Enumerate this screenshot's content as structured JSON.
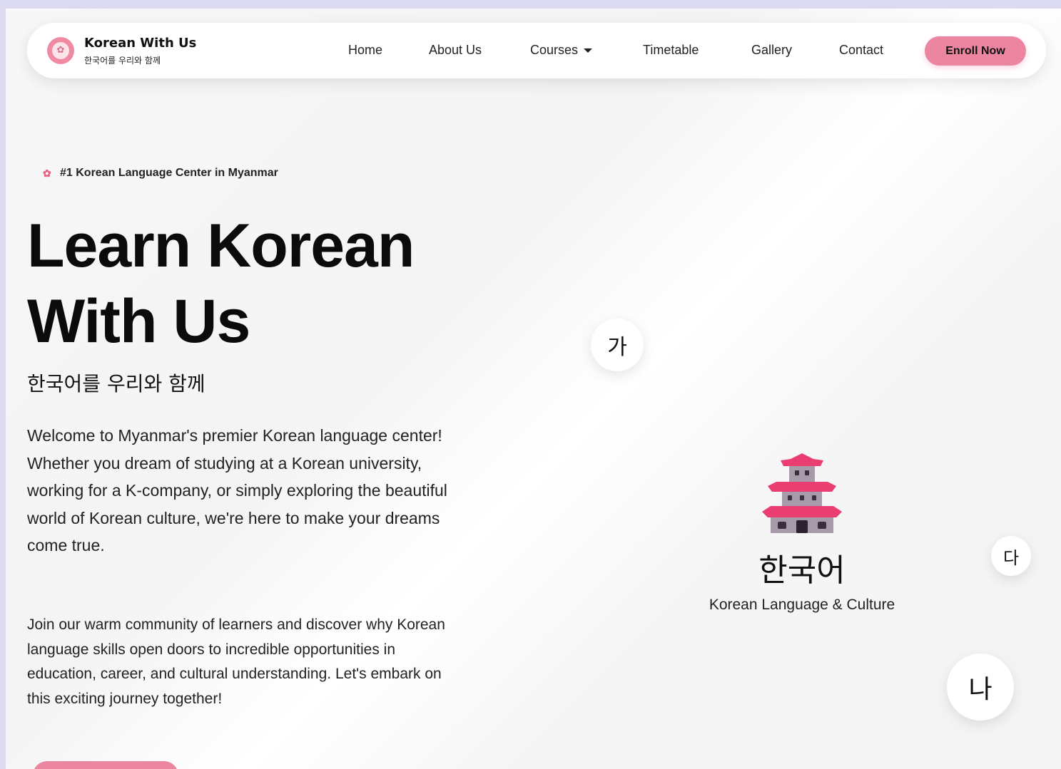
{
  "brand": {
    "title": "Korean With Us",
    "subtitle": "한국어를 우리와 함께",
    "logo_glyph": "✿"
  },
  "nav": {
    "home": "Home",
    "about": "About Us",
    "courses": "Courses",
    "timetable": "Timetable",
    "gallery": "Gallery",
    "contact": "Contact",
    "enroll": "Enroll Now"
  },
  "hero": {
    "badge_icon": "✿",
    "badge": "#1 Korean Language Center in Myanmar",
    "title_line1": "Learn Korean",
    "title_line2": "With Us",
    "subtitle": "한국어를 우리와 함께",
    "paragraph1": "Welcome to Myanmar's premier Korean language center! Whether you dream of studying at a Korean university, working for a K-company, or simply exploring the beautiful world of Korean culture, we're here to make your dreams come true.",
    "paragraph2": "Join our warm community of learners and discover why Korean language skills open doors to incredible opportunities in education, career, and cultural understanding. Let's embark on this exciting journey together!"
  },
  "visual": {
    "bubble_ga": "가",
    "bubble_da": "다",
    "bubble_na": "나",
    "korean_word": "한국어",
    "caption": "Korean Language & Culture",
    "pagoda_icon": "pagoda-icon"
  },
  "colors": {
    "accent": "#ec86a0",
    "pagoda_pink": "#ea3e72",
    "pagoda_stone": "#a79ba9"
  }
}
